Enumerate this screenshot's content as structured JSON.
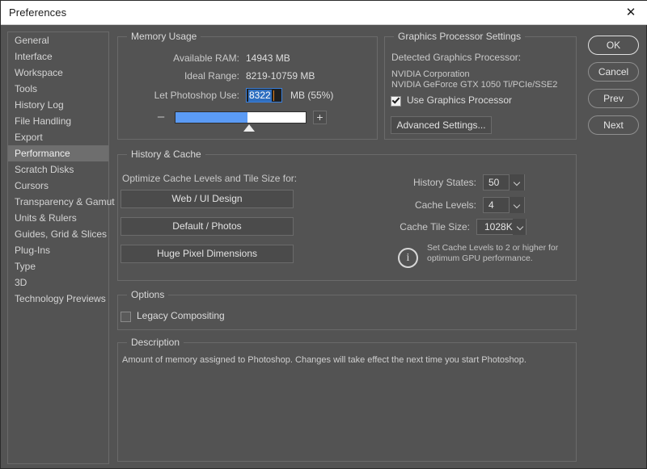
{
  "window": {
    "title": "Preferences",
    "close_icon": "close-icon"
  },
  "sidebar": {
    "items": [
      {
        "label": "General",
        "selected": false
      },
      {
        "label": "Interface",
        "selected": false
      },
      {
        "label": "Workspace",
        "selected": false
      },
      {
        "label": "Tools",
        "selected": false
      },
      {
        "label": "History Log",
        "selected": false
      },
      {
        "label": "File Handling",
        "selected": false
      },
      {
        "label": "Export",
        "selected": false
      },
      {
        "label": "Performance",
        "selected": true
      },
      {
        "label": "Scratch Disks",
        "selected": false
      },
      {
        "label": "Cursors",
        "selected": false
      },
      {
        "label": "Transparency & Gamut",
        "selected": false
      },
      {
        "label": "Units & Rulers",
        "selected": false
      },
      {
        "label": "Guides, Grid & Slices",
        "selected": false
      },
      {
        "label": "Plug-Ins",
        "selected": false
      },
      {
        "label": "Type",
        "selected": false
      },
      {
        "label": "3D",
        "selected": false
      },
      {
        "label": "Technology Previews",
        "selected": false
      }
    ]
  },
  "memory_usage": {
    "group_label": "Memory Usage",
    "available_ram_label": "Available RAM:",
    "available_ram_value": "14943 MB",
    "ideal_range_label": "Ideal Range:",
    "ideal_range_value": "8219-10759 MB",
    "let_photoshop_use_label": "Let Photoshop Use:",
    "let_photoshop_use_value": "8322",
    "unit_and_percent": "MB (55%)",
    "slider_percent": 55,
    "minus_label": "–",
    "plus_label": "+"
  },
  "graphics": {
    "group_label": "Graphics Processor Settings",
    "detected_label": "Detected Graphics Processor:",
    "vendor": "NVIDIA Corporation",
    "model": "NVIDIA GeForce GTX 1050 Ti/PCIe/SSE2",
    "use_gpu_label": "Use Graphics Processor",
    "use_gpu_checked": true,
    "advanced_button": "Advanced Settings..."
  },
  "history_cache": {
    "group_label": "History & Cache",
    "optimize_label": "Optimize Cache Levels and Tile Size for:",
    "presets": [
      {
        "label": "Web / UI Design"
      },
      {
        "label": "Default / Photos"
      },
      {
        "label": "Huge Pixel Dimensions"
      }
    ],
    "history_states_label": "History States:",
    "history_states_value": "50",
    "cache_levels_label": "Cache Levels:",
    "cache_levels_value": "4",
    "cache_tile_size_label": "Cache Tile Size:",
    "cache_tile_size_value": "1028K",
    "info_icon": "info-icon",
    "info_text": "Set Cache Levels to 2 or higher for optimum GPU performance."
  },
  "options": {
    "group_label": "Options",
    "legacy_compositing_label": "Legacy Compositing",
    "legacy_compositing_checked": false
  },
  "description": {
    "group_label": "Description",
    "text": "Amount of memory assigned to Photoshop. Changes will take effect the next time you start Photoshop."
  },
  "actions": {
    "ok": "OK",
    "cancel": "Cancel",
    "prev": "Prev",
    "next": "Next"
  },
  "colors": {
    "dialog_bg": "#535353",
    "sidebar_selected": "#6e6e6e",
    "slider_fill": "#5b9bf5",
    "field_focus_border": "#3a7fdc",
    "titlebar_bg": "#ffffff"
  }
}
